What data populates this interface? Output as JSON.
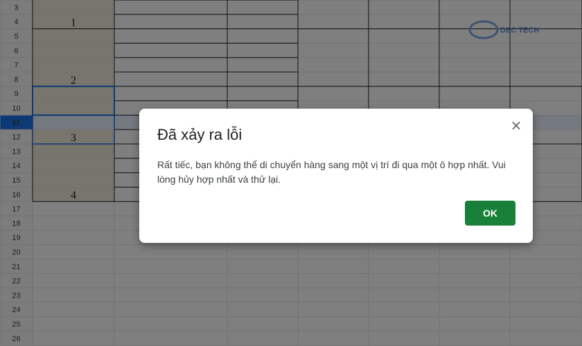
{
  "sheet": {
    "row_numbers": [
      "3",
      "4",
      "5",
      "6",
      "7",
      "8",
      "9",
      "10",
      "11",
      "12",
      "13",
      "14",
      "15",
      "16",
      "17",
      "18",
      "19",
      "20",
      "21",
      "22",
      "23",
      "24",
      "25",
      "26"
    ],
    "merged_values": [
      "1",
      "2",
      "3",
      "4"
    ],
    "selected_row": "11"
  },
  "watermark": {
    "text": "DEC TECH"
  },
  "dialog": {
    "title": "Đã xảy ra lỗi",
    "message": "Rất tiếc, bạn không thể di chuyển hàng sang một vị trí đi qua một ô hợp nhất. Vui lòng hủy hợp nhất và thử lại.",
    "ok_label": "OK",
    "close_glyph": "×"
  },
  "colors": {
    "overlay": "#808080",
    "merged_fill": "#eeebd9",
    "ok_button": "#188038",
    "selection": "#1a73e8"
  }
}
